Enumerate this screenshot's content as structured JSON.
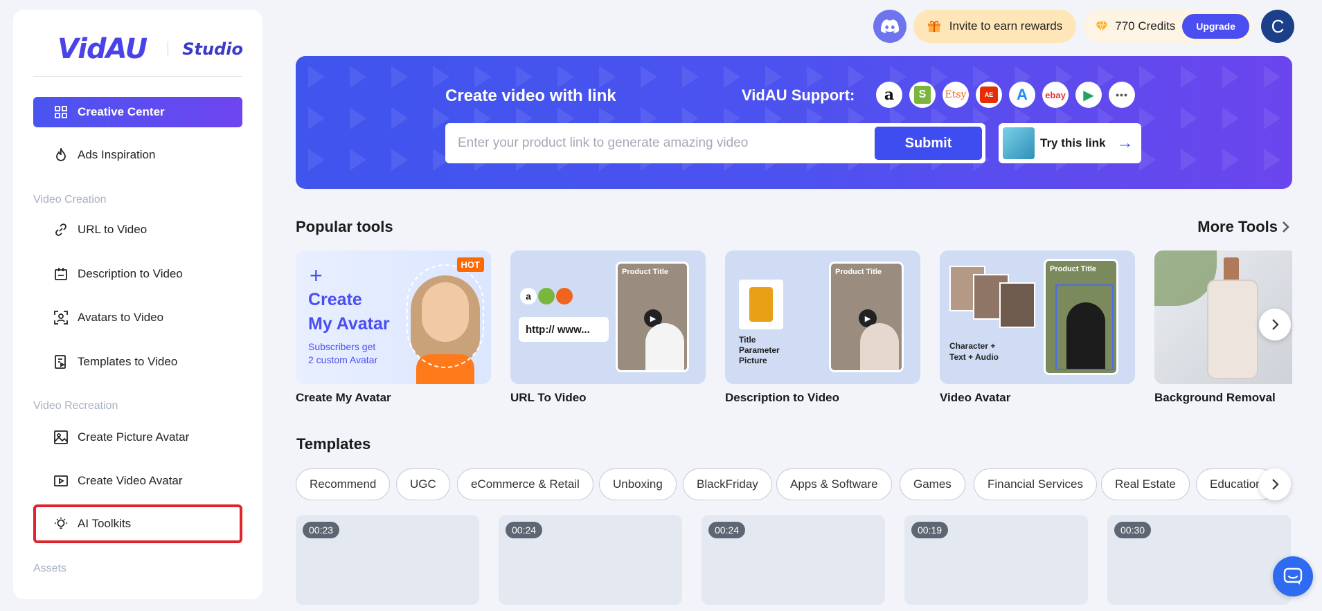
{
  "brand": {
    "logo": "VidAU",
    "product": "Studio"
  },
  "sidebar": {
    "primary": [
      {
        "label": "Creative Center",
        "icon": "grid-icon"
      },
      {
        "label": "Ads Inspiration",
        "icon": "flame-icon"
      }
    ],
    "video_creation": {
      "heading": "Video Creation",
      "items": [
        {
          "label": "URL to Video",
          "icon": "link-icon"
        },
        {
          "label": "Description to Video",
          "icon": "document-icon"
        },
        {
          "label": "Avatars to Video",
          "icon": "avatar-frame-icon"
        },
        {
          "label": "Templates to Video",
          "icon": "template-icon"
        }
      ]
    },
    "video_recreation": {
      "heading": "Video Recreation",
      "items": [
        {
          "label": "Create Picture Avatar",
          "icon": "image-icon"
        },
        {
          "label": "Create Video Avatar",
          "icon": "video-icon"
        },
        {
          "label": "AI Toolkits",
          "icon": "lightbulb-icon"
        }
      ]
    },
    "assets_heading": "Assets"
  },
  "topbar": {
    "invite_label": "Invite to earn rewards",
    "credits_label": "770 Credits",
    "upgrade_label": "Upgrade",
    "avatar_initial": "C"
  },
  "hero": {
    "title": "Create video with link",
    "support_label": "VidAU Support:",
    "support_platforms": [
      {
        "name": "amazon-icon",
        "glyph": "a"
      },
      {
        "name": "shopify-icon",
        "glyph": "S"
      },
      {
        "name": "etsy-icon",
        "glyph": "Etsy"
      },
      {
        "name": "aliexpress-icon",
        "glyph": "AE"
      },
      {
        "name": "app-store-icon",
        "glyph": "A"
      },
      {
        "name": "ebay-icon",
        "glyph": "ebay"
      },
      {
        "name": "google-play-icon",
        "glyph": "▶"
      },
      {
        "name": "more-icon",
        "glyph": "•••"
      }
    ],
    "input_placeholder": "Enter your product link to generate amazing video",
    "submit_label": "Submit",
    "try_label": "Try this link"
  },
  "popular_tools": {
    "title": "Popular tools",
    "more_label": "More Tools",
    "tools": [
      {
        "name": "Create My Avatar",
        "badge": "HOT",
        "card_title_line1": "Create",
        "card_title_line2": "My Avatar",
        "card_sub_line1": "Subscribers get",
        "card_sub_line2": "2 custom Avatar"
      },
      {
        "name": "URL To Video",
        "card_text": "http:// www...",
        "card_label": "Product Title"
      },
      {
        "name": "Description to Video",
        "card_label": "Product Title",
        "card_text_line1": "Title",
        "card_text_line2": "Parameter",
        "card_text_line3": "Picture"
      },
      {
        "name": "Video Avatar",
        "card_label": "Product Title",
        "card_text_line1": "Character +",
        "card_text_line2": "Text + Audio"
      },
      {
        "name": "Background Removal"
      }
    ]
  },
  "templates": {
    "title": "Templates",
    "categories": [
      "Recommend",
      "UGC",
      "eCommerce & Retail",
      "Unboxing",
      "BlackFriday",
      "Apps & Software",
      "Games",
      "Financial Services",
      "Real Estate",
      "Education"
    ],
    "durations": [
      "00:23",
      "00:24",
      "00:24",
      "00:19",
      "00:30"
    ]
  },
  "colors": {
    "accent": "#4a4ef0",
    "highlight_border": "#e0242c",
    "page_bg": "#f2f4fa"
  }
}
